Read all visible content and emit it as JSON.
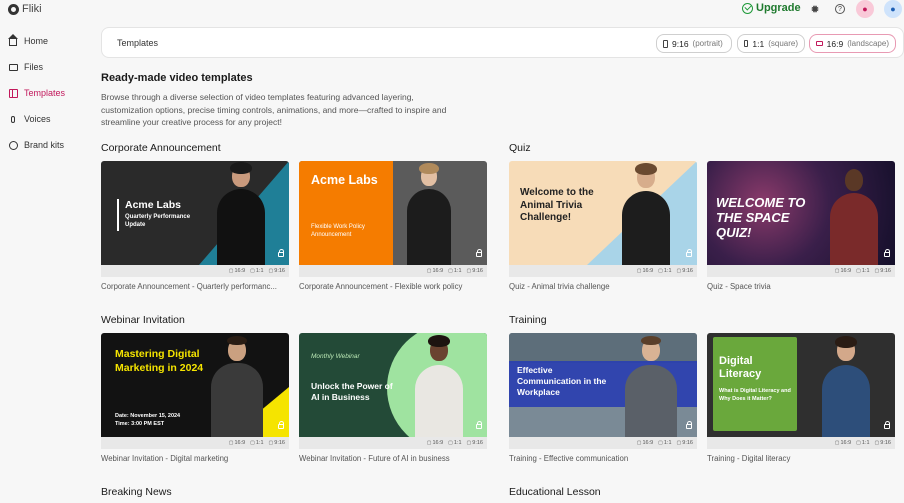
{
  "app": {
    "name": "Fliki"
  },
  "topbar": {
    "upgrade_label": "Upgrade"
  },
  "sidebar": {
    "items": [
      {
        "label": "Home",
        "icon": "home-icon"
      },
      {
        "label": "Files",
        "icon": "folder-icon"
      },
      {
        "label": "Templates",
        "icon": "templates-icon",
        "active": true
      },
      {
        "label": "Voices",
        "icon": "microphone-icon"
      },
      {
        "label": "Brand kits",
        "icon": "palette-icon"
      }
    ]
  },
  "header": {
    "title": "Templates",
    "ratios": [
      {
        "label": "9:16",
        "sub": "(portrait)"
      },
      {
        "label": "1:1",
        "sub": "(square)"
      },
      {
        "label": "16:9",
        "sub": "(landscape)",
        "active": true
      }
    ]
  },
  "intro": {
    "title": "Ready-made video templates",
    "description": "Browse through a diverse selection of video templates featuring advanced layering, customization options, precise timing controls, animations, and more—crafted to inspire and streamline your creative process for any project!"
  },
  "ratio_tags": [
    "16:9",
    "1:1",
    "9:16"
  ],
  "sections": [
    {
      "title": "Corporate Announcement",
      "cards": [
        {
          "label": "Corporate Announcement - Quarterly performanc...",
          "overlay_title": "Acme Labs",
          "overlay_sub": "Quarterly Performance Update"
        },
        {
          "label": "Corporate Announcement - Flexible work policy",
          "overlay_title": "Acme Labs",
          "overlay_sub": "Flexible Work Policy Announcement"
        }
      ]
    },
    {
      "title": "Quiz",
      "cards": [
        {
          "label": "Quiz - Animal trivia challenge",
          "overlay_title": "Welcome to the Animal Trivia Challenge!"
        },
        {
          "label": "Quiz - Space trivia",
          "overlay_title": "WELCOME TO THE SPACE QUIZ!"
        }
      ]
    },
    {
      "title": "Webinar Invitation",
      "cards": [
        {
          "label": "Webinar Invitation - Digital marketing",
          "overlay_title": "Mastering Digital Marketing in 2024",
          "overlay_sub": "Date: November 15, 2024\nTime: 3:00 PM EST"
        },
        {
          "label": "Webinar Invitation - Future of AI in business",
          "overlay_title": "Unlock the Power of AI in Business",
          "overlay_sub": "Monthly Webinar"
        }
      ]
    },
    {
      "title": "Training",
      "cards": [
        {
          "label": "Training - Effective communication",
          "overlay_title": "Effective Communication in the Workplace"
        },
        {
          "label": "Training - Digital literacy",
          "overlay_title": "Digital Literacy",
          "overlay_sub": "What is Digital Literacy and Why Does it Matter?"
        }
      ]
    },
    {
      "title": "Breaking News",
      "cards": []
    },
    {
      "title": "Educational Lesson",
      "cards": []
    }
  ]
}
